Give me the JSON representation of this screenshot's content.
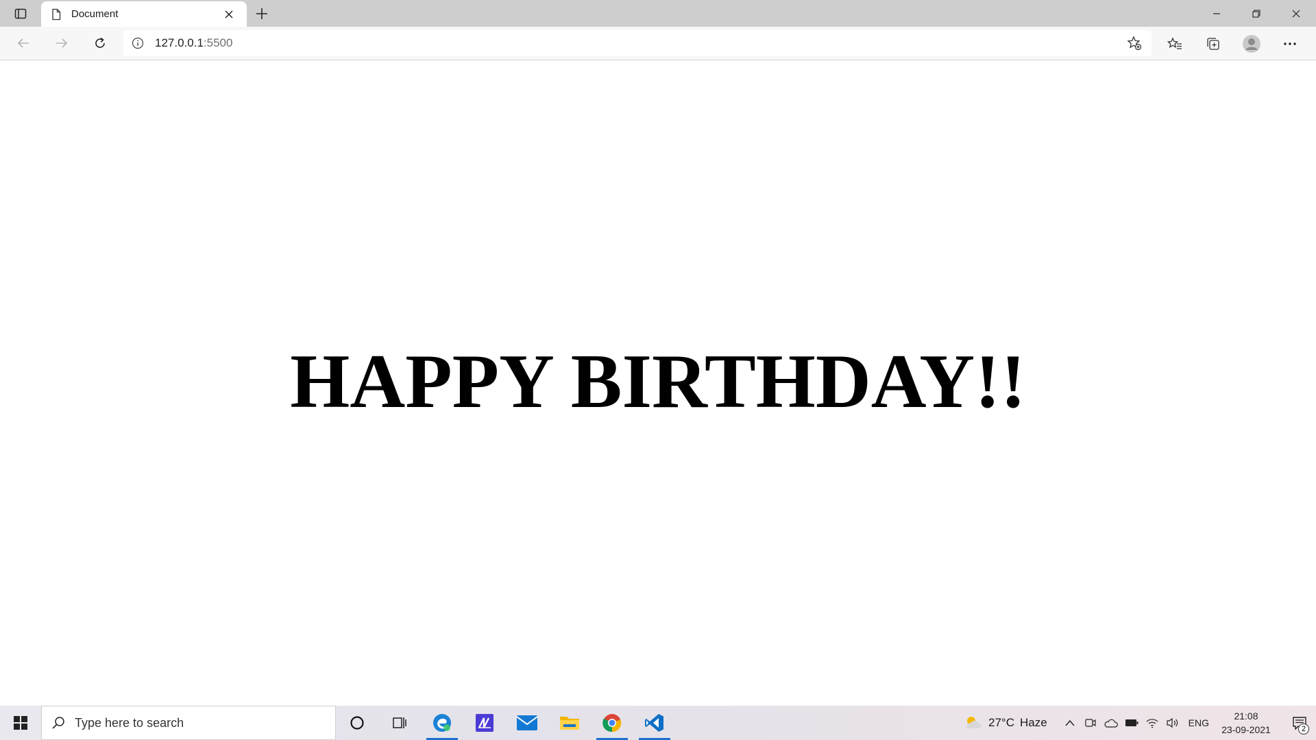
{
  "browser": {
    "tab": {
      "title": "Document"
    },
    "address": {
      "host": "127.0.0.1",
      "port": ":5500"
    }
  },
  "page": {
    "headline": "HAPPY BIRTHDAY!!"
  },
  "taskbar": {
    "search_placeholder": "Type here to search",
    "weather": {
      "temp": "27°C",
      "condition": "Haze"
    },
    "language": "ENG",
    "time": "21:08",
    "date": "23-09-2021",
    "notification_count": "2"
  }
}
